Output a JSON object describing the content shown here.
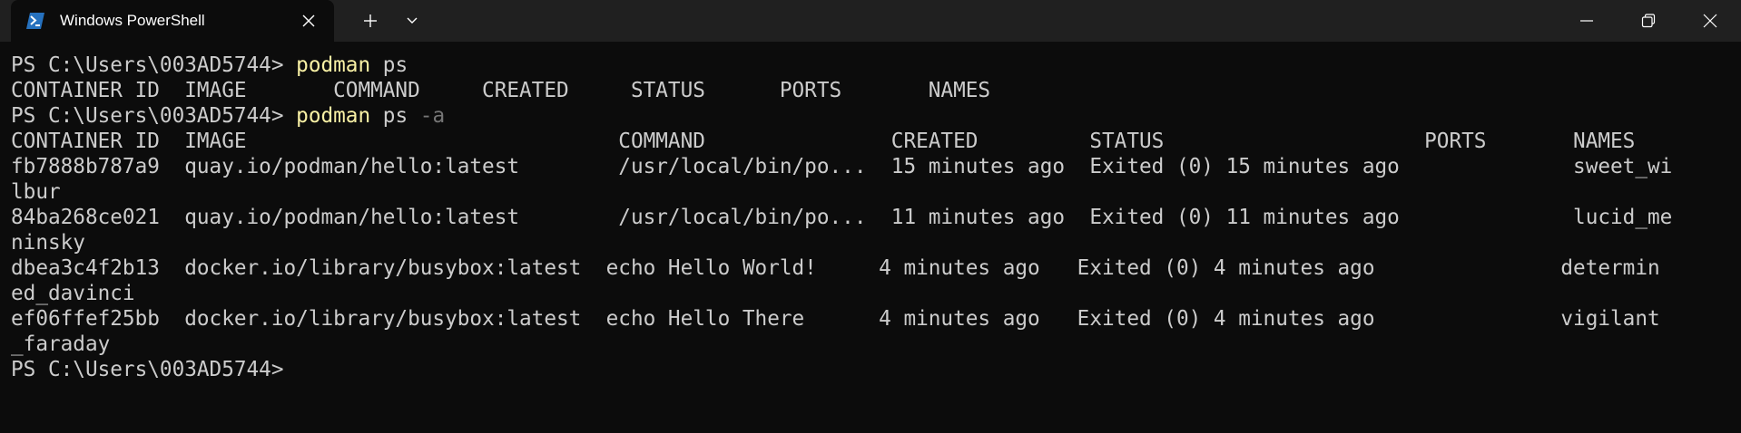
{
  "window": {
    "tab_title": "Windows PowerShell",
    "tab_icon": "powershell-icon",
    "new_tab_icon": "plus-icon",
    "dropdown_icon": "chevron-down-icon",
    "controls": [
      "minimize-icon",
      "restore-icon",
      "close-icon"
    ]
  },
  "colors": {
    "background": "#0c0c0c",
    "titlebar": "#202020",
    "text": "#cccccc",
    "command": "#f9f1a5",
    "parameter": "#767676",
    "powershell_blue": "#2671be"
  },
  "terminal": {
    "lines": [
      {
        "prompt": "PS C:\\Users\\003AD5744> ",
        "command": "podman",
        "args": " ps",
        "flag": ""
      },
      {
        "text": "CONTAINER ID  IMAGE       COMMAND     CREATED     STATUS      PORTS       NAMES"
      },
      {
        "prompt": "PS C:\\Users\\003AD5744> ",
        "command": "podman",
        "args": " ps ",
        "flag": "-a"
      },
      {
        "text": "CONTAINER ID  IMAGE                              COMMAND               CREATED         STATUS                     PORTS       NAMES"
      },
      {
        "text": "fb7888b787a9  quay.io/podman/hello:latest        /usr/local/bin/po...  15 minutes ago  Exited (0) 15 minutes ago              sweet_wi"
      },
      {
        "text": "lbur"
      },
      {
        "text": "84ba268ce021  quay.io/podman/hello:latest        /usr/local/bin/po...  11 minutes ago  Exited (0) 11 minutes ago              lucid_me"
      },
      {
        "text": "ninsky"
      },
      {
        "text": "dbea3c4f2b13  docker.io/library/busybox:latest  echo Hello World!     4 minutes ago   Exited (0) 4 minutes ago               determin"
      },
      {
        "text": "ed_davinci"
      },
      {
        "text": "ef06ffef25bb  docker.io/library/busybox:latest  echo Hello There      4 minutes ago   Exited (0) 4 minutes ago               vigilant"
      },
      {
        "text": "_faraday"
      },
      {
        "prompt": "PS C:\\Users\\003AD5744>",
        "command": "",
        "args": "",
        "flag": ""
      }
    ]
  }
}
